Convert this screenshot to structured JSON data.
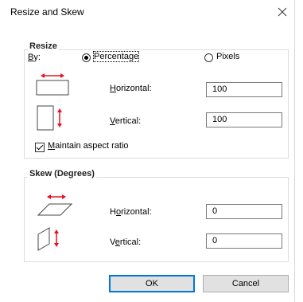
{
  "dialog": {
    "title": "Resize and Skew",
    "close_icon": "close-icon"
  },
  "resize": {
    "group_label": "Resize",
    "by_label": "By:",
    "percentage_label": "Percentage",
    "percentage_selected": true,
    "pixels_label": "Pixels",
    "pixels_selected": false,
    "horizontal_label": "Horizontal:",
    "horizontal_value": "100",
    "vertical_label": "Vertical:",
    "vertical_value": "100",
    "maintain_label": "Maintain aspect ratio",
    "maintain_checked": true
  },
  "skew": {
    "group_label": "Skew (Degrees)",
    "horizontal_label": "Horizontal:",
    "horizontal_value": "0",
    "vertical_label": "Vertical:",
    "vertical_value": "0"
  },
  "buttons": {
    "ok_label": "OK",
    "cancel_label": "Cancel"
  },
  "colors": {
    "accent_arrow": "#e81123",
    "default_button_border": "#0078d7"
  }
}
